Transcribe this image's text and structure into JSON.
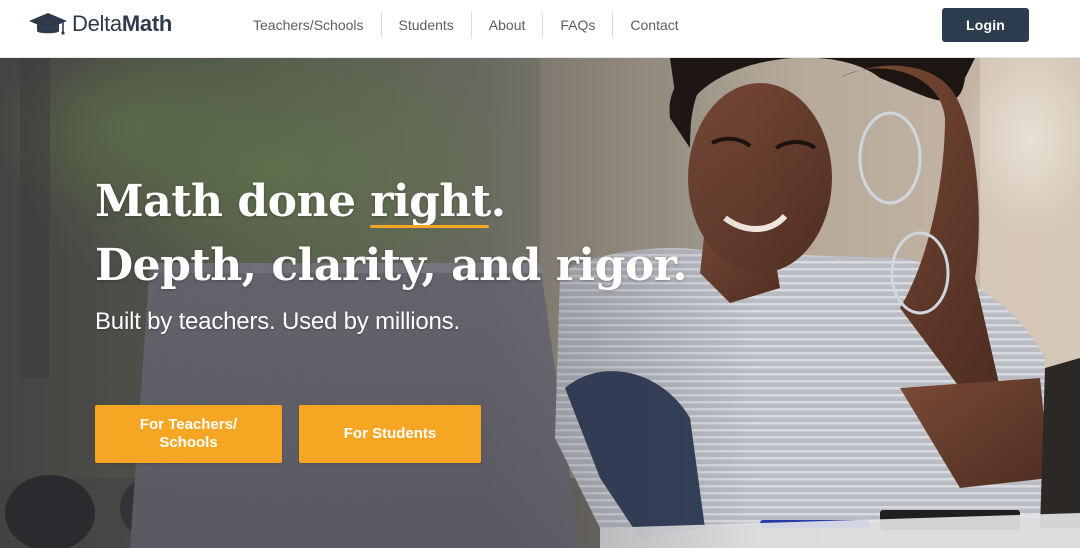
{
  "brand": {
    "name_part1": "Delta",
    "name_part2": "Math",
    "logo_icon": "graduation-cap-icon",
    "color": "#2f3b4a"
  },
  "nav": {
    "links": [
      {
        "label": "Teachers/Schools"
      },
      {
        "label": "Students"
      },
      {
        "label": "About"
      },
      {
        "label": "FAQs"
      },
      {
        "label": "Contact"
      }
    ],
    "login_label": "Login",
    "login_color": "#2e3c4f"
  },
  "hero": {
    "headline_line1_before": "Math done ",
    "headline_line1_accent": "right",
    "headline_line1_after": ".",
    "headline_line2": "Depth, clarity, and rigor.",
    "subheadline": "Built by teachers. Used by millions.",
    "accent_color": "#f5a623",
    "cta_teachers_label": "For Teachers/ Schools",
    "cta_students_label": "For Students",
    "cta_color": "#f6a623"
  }
}
